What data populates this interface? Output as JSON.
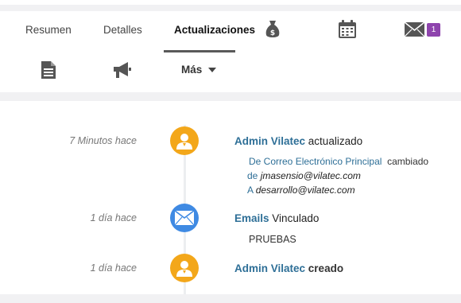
{
  "tabs": [
    {
      "label": "Resumen"
    },
    {
      "label": "Detalles"
    },
    {
      "label": "Actualizaciones"
    }
  ],
  "icons": {
    "money": "money-bag-icon",
    "calendar": "calendar-icon",
    "mail": "envelope-icon",
    "notes": "document-icon",
    "campaign": "megaphone-icon"
  },
  "mail_badge": "1",
  "more_label": "Más",
  "colors": {
    "accent_link": "#2e6f97",
    "avatar_orange": "#f3a71a",
    "avatar_blue": "#3f8ae3",
    "badge_purple": "#8e44ad"
  },
  "events": [
    {
      "time": "7 Minutos hace",
      "actor": "Admin Vilatec",
      "action": "actualizado",
      "detail": {
        "field": "De Correo Electrónico Principal",
        "changed": "cambiado",
        "from_label": "de",
        "from_value": "jmasensio@vilatec.com",
        "to_label": "A",
        "to_value": "desarrollo@vilatec.com"
      }
    },
    {
      "time": "1 día hace",
      "actor": "Emails",
      "action": "Vinculado",
      "detail_text": "PRUEBAS"
    },
    {
      "time": "1 día hace",
      "actor": "Admin Vilatec",
      "action": "creado"
    }
  ]
}
